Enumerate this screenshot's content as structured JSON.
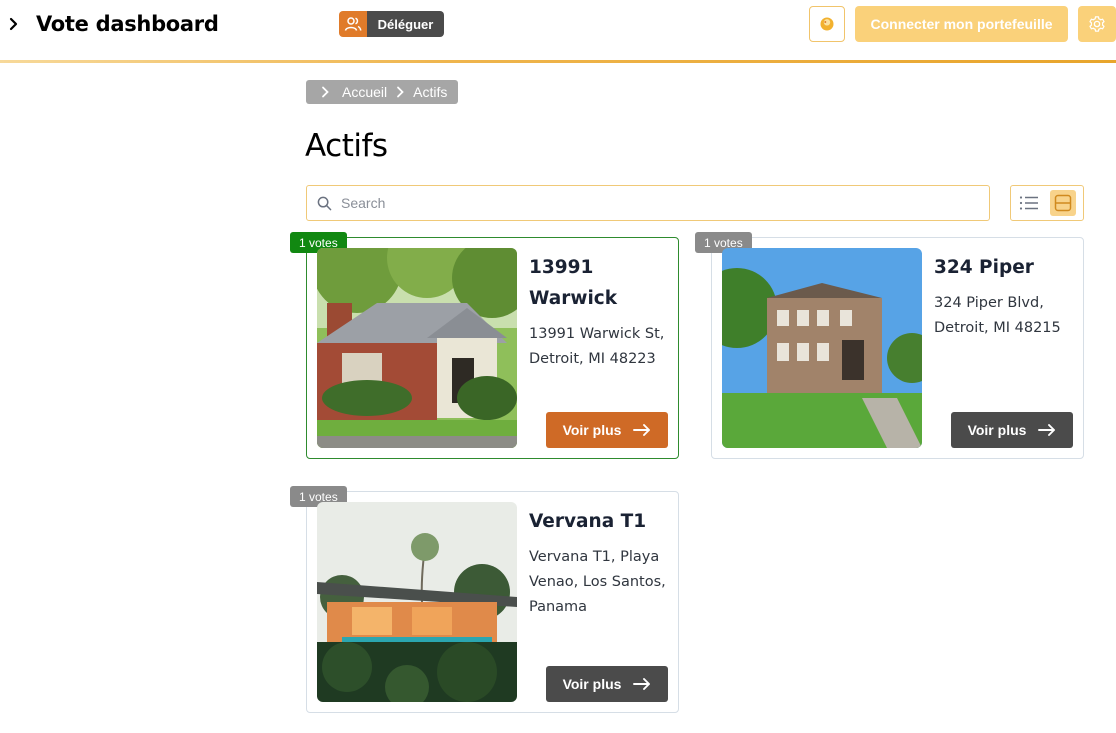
{
  "header": {
    "title": "Vote dashboard",
    "delegate_label": "Déléguer",
    "wallet_label": "Connecter mon portefeuille",
    "accent": "#e8a52c"
  },
  "breadcrumb": {
    "items": [
      "Accueil",
      "Actifs"
    ]
  },
  "page": {
    "title": "Actifs"
  },
  "search": {
    "placeholder": "Search",
    "value": ""
  },
  "view": {
    "selected": "grid"
  },
  "assets": [
    {
      "votes_label": "1 votes",
      "name": "13991 Warwick",
      "name_lines": [
        "13991",
        "Warwick"
      ],
      "address_lines": [
        "13991 Warwick St,",
        "Detroit, MI 48223"
      ],
      "button_label": "Voir plus",
      "selected": true,
      "badge_color": "#118811",
      "button_color": "#cf6a26"
    },
    {
      "votes_label": "1 votes",
      "name": "324 Piper",
      "address_lines": [
        "324 Piper Blvd,",
        "Detroit, MI 48215"
      ],
      "button_label": "Voir plus",
      "selected": false,
      "badge_color": "#8a8a8a",
      "button_color": "#4b4b4b"
    },
    {
      "votes_label": "1 votes",
      "name": "Vervana T1",
      "address_lines": [
        "Vervana T1, Playa",
        "Venao, Los Santos,",
        "Panama"
      ],
      "button_label": "Voir plus",
      "selected": false,
      "badge_color": "#8a8a8a",
      "button_color": "#4b4b4b"
    }
  ]
}
